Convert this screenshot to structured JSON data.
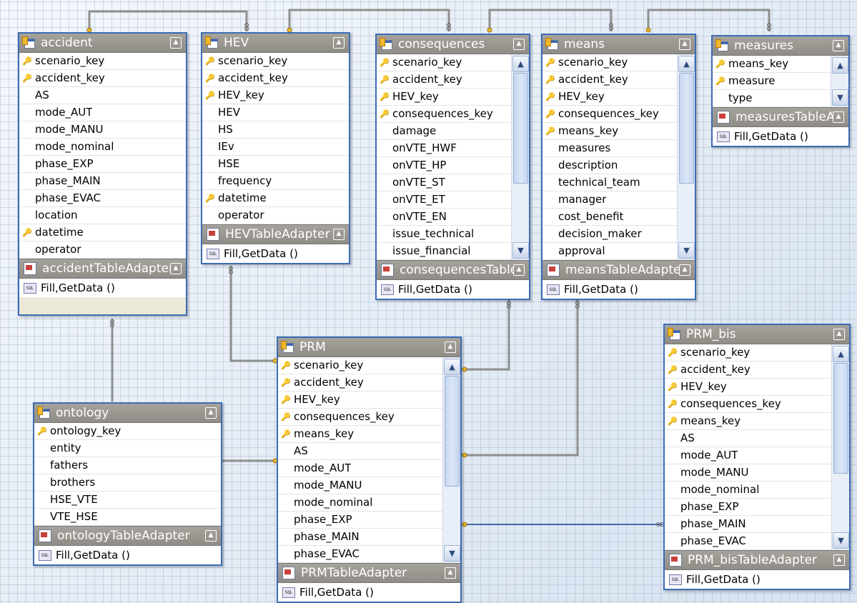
{
  "method_label": "Fill,GetData ()",
  "tables": {
    "accident": {
      "name": "accident",
      "fields": [
        {
          "name": "scenario_key",
          "key": true
        },
        {
          "name": "accident_key",
          "key": true
        },
        {
          "name": "AS",
          "key": false
        },
        {
          "name": "mode_AUT",
          "key": false
        },
        {
          "name": "mode_MANU",
          "key": false
        },
        {
          "name": "mode_nominal",
          "key": false
        },
        {
          "name": "phase_EXP",
          "key": false
        },
        {
          "name": "phase_MAIN",
          "key": false
        },
        {
          "name": "phase_EVAC",
          "key": false
        },
        {
          "name": "location",
          "key": false
        },
        {
          "name": "datetime",
          "key": true
        },
        {
          "name": "operator",
          "key": false
        }
      ],
      "adapter": "accidentTableAdapter"
    },
    "hev": {
      "name": "HEV",
      "fields": [
        {
          "name": "scenario_key",
          "key": true
        },
        {
          "name": "accident_key",
          "key": true
        },
        {
          "name": "HEV_key",
          "key": true
        },
        {
          "name": "HEV",
          "key": false
        },
        {
          "name": "HS",
          "key": false
        },
        {
          "name": "IEv",
          "key": false
        },
        {
          "name": "HSE",
          "key": false
        },
        {
          "name": "frequency",
          "key": false
        },
        {
          "name": "datetime",
          "key": true
        },
        {
          "name": "operator",
          "key": false
        }
      ],
      "adapter": "HEVTableAdapter"
    },
    "consequences": {
      "name": "consequences",
      "fields": [
        {
          "name": "scenario_key",
          "key": true
        },
        {
          "name": "accident_key",
          "key": true
        },
        {
          "name": "HEV_key",
          "key": true
        },
        {
          "name": "consequences_key",
          "key": true
        },
        {
          "name": "damage",
          "key": false
        },
        {
          "name": "onVTE_HWF",
          "key": false
        },
        {
          "name": "onVTE_HP",
          "key": false
        },
        {
          "name": "onVTE_ST",
          "key": false
        },
        {
          "name": "onVTE_ET",
          "key": false
        },
        {
          "name": "onVTE_EN",
          "key": false
        },
        {
          "name": "issue_technical",
          "key": false
        },
        {
          "name": "issue_financial",
          "key": false
        }
      ],
      "adapter": "consequencesTableAdapter"
    },
    "means": {
      "name": "means",
      "fields": [
        {
          "name": "scenario_key",
          "key": true
        },
        {
          "name": "accident_key",
          "key": true
        },
        {
          "name": "HEV_key",
          "key": true
        },
        {
          "name": "consequences_key",
          "key": true
        },
        {
          "name": "means_key",
          "key": true
        },
        {
          "name": "measures",
          "key": false
        },
        {
          "name": "description",
          "key": false
        },
        {
          "name": "technical_team",
          "key": false
        },
        {
          "name": "manager",
          "key": false
        },
        {
          "name": "cost_benefit",
          "key": false
        },
        {
          "name": "decision_maker",
          "key": false
        },
        {
          "name": "approval",
          "key": false
        }
      ],
      "adapter": "meansTableAdapter"
    },
    "measures": {
      "name": "measures",
      "fields": [
        {
          "name": "means_key",
          "key": true
        },
        {
          "name": "measure",
          "key": true
        },
        {
          "name": "type",
          "key": false
        }
      ],
      "adapter": "measuresTableAdapter"
    },
    "prm": {
      "name": "PRM",
      "fields": [
        {
          "name": "scenario_key",
          "key": true
        },
        {
          "name": "accident_key",
          "key": true
        },
        {
          "name": "HEV_key",
          "key": true
        },
        {
          "name": "consequences_key",
          "key": true
        },
        {
          "name": "means_key",
          "key": true
        },
        {
          "name": "AS",
          "key": false
        },
        {
          "name": "mode_AUT",
          "key": false
        },
        {
          "name": "mode_MANU",
          "key": false
        },
        {
          "name": "mode_nominal",
          "key": false
        },
        {
          "name": "phase_EXP",
          "key": false
        },
        {
          "name": "phase_MAIN",
          "key": false
        },
        {
          "name": "phase_EVAC",
          "key": false
        }
      ],
      "adapter": "PRMTableAdapter"
    },
    "ontology": {
      "name": "ontology",
      "fields": [
        {
          "name": "ontology_key",
          "key": true
        },
        {
          "name": "entity",
          "key": false
        },
        {
          "name": "fathers",
          "key": false
        },
        {
          "name": "brothers",
          "key": false
        },
        {
          "name": "HSE_VTE",
          "key": false
        },
        {
          "name": "VTE_HSE",
          "key": false
        }
      ],
      "adapter": "ontologyTableAdapter"
    },
    "prm_bis": {
      "name": "PRM_bis",
      "fields": [
        {
          "name": "scenario_key",
          "key": true
        },
        {
          "name": "accident_key",
          "key": true
        },
        {
          "name": "HEV_key",
          "key": true
        },
        {
          "name": "consequences_key",
          "key": true
        },
        {
          "name": "means_key",
          "key": true
        },
        {
          "name": "AS",
          "key": false
        },
        {
          "name": "mode_AUT",
          "key": false
        },
        {
          "name": "mode_MANU",
          "key": false
        },
        {
          "name": "mode_nominal",
          "key": false
        },
        {
          "name": "phase_EXP",
          "key": false
        },
        {
          "name": "phase_MAIN",
          "key": false
        },
        {
          "name": "phase_EVAC",
          "key": false
        }
      ],
      "adapter": "PRM_bisTableAdapter"
    }
  }
}
